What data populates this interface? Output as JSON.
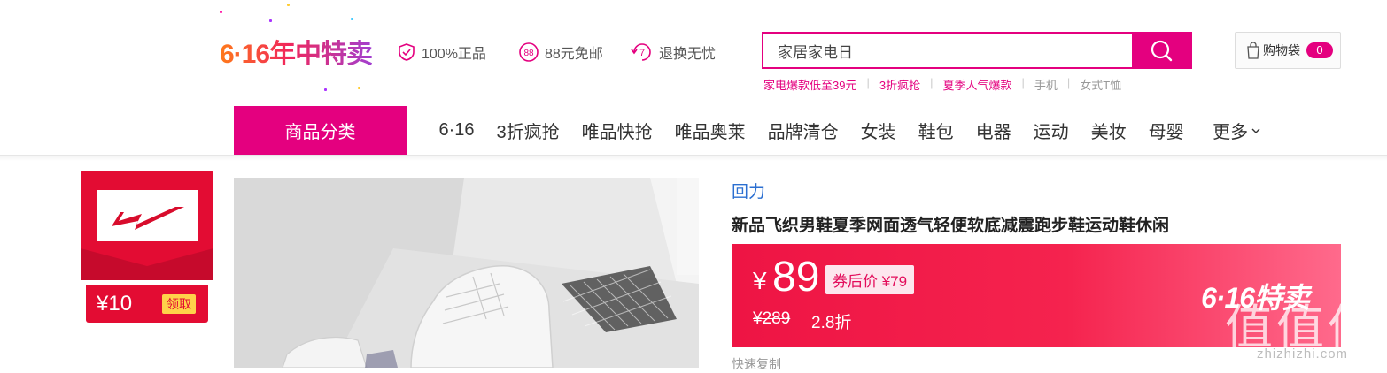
{
  "header": {
    "logo_text": "6·16年中特卖",
    "promises": [
      {
        "icon": "shield-check-icon",
        "label": "100%正品"
      },
      {
        "icon": "free-shipping-88-icon",
        "label": "88元免邮"
      },
      {
        "icon": "return-7-day-icon",
        "label": "退换无忧"
      }
    ],
    "search": {
      "value": "家居家电日",
      "button_icon": "search-icon"
    },
    "hot_words": [
      {
        "label": "家电爆款低至39元",
        "highlight": true
      },
      {
        "label": "3折疯抢",
        "highlight": true
      },
      {
        "label": "夏季人气爆款",
        "highlight": true
      },
      {
        "label": "手机",
        "highlight": false
      },
      {
        "label": "女式T恤",
        "highlight": false
      }
    ],
    "cart": {
      "label": "购物袋",
      "count": "0",
      "icon": "shopping-bag-icon"
    }
  },
  "nav": {
    "category_label": "商品分类",
    "items": [
      "6·16",
      "3折疯抢",
      "唯品快抢",
      "唯品奥莱",
      "品牌清仓",
      "女装",
      "鞋包",
      "电器",
      "运动",
      "美妆",
      "母婴"
    ],
    "more_label": "更多"
  },
  "brand_card": {
    "logo_icon": "huili-brand-logo-icon",
    "coupon_amount": "¥10",
    "claim_label": "领取"
  },
  "product": {
    "brand": "回力",
    "title": "新品飞织男鞋夏季网面透气轻便软底减震跑步鞋运动鞋休闲",
    "price_currency": "¥",
    "price": "89",
    "coupon_price": "券后价 ¥79",
    "original_price": "¥289",
    "discount": "2.8折",
    "sale_badge": "6·16特卖",
    "bottom_text": "快速复制"
  },
  "watermark": {
    "glyphs": "值值值",
    "site": "zhizhizhi.com"
  },
  "colors": {
    "accent": "#e4007f",
    "brand_red": "#e30c33",
    "link_blue": "#2b6fd1",
    "price_gradient_start": "#ee1444",
    "price_gradient_end": "#ff6a8c"
  }
}
